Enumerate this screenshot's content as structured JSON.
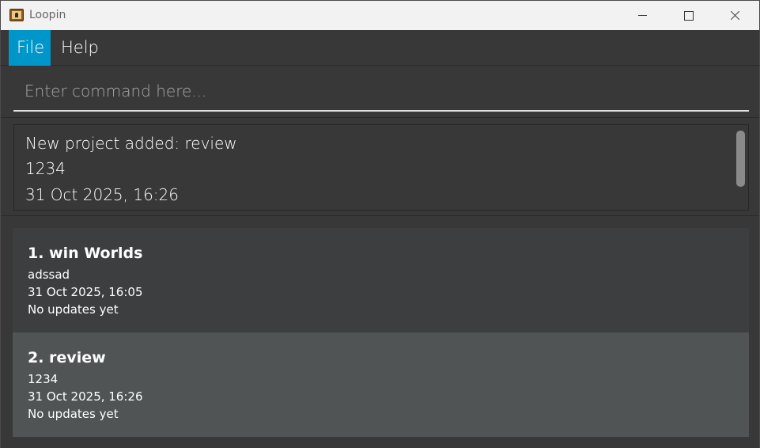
{
  "window": {
    "title": "Loopin"
  },
  "menu": [
    {
      "label": "File"
    },
    {
      "label": "Help"
    }
  ],
  "command": {
    "value": "",
    "placeholder": "Enter command here..."
  },
  "result": {
    "lines": [
      "New project added: review",
      "1234",
      "31 Oct 2025, 16:26"
    ]
  },
  "projects": [
    {
      "title": "1. win Worlds",
      "description": "adssad",
      "datetime": "31 Oct 2025, 16:05",
      "updates": "No updates yet"
    },
    {
      "title": "2. review",
      "description": "1234",
      "datetime": "31 Oct 2025, 16:26",
      "updates": "No updates yet"
    }
  ],
  "colors": {
    "accent": "#0096c9",
    "background": "#383838",
    "selected_card": "#505455"
  }
}
